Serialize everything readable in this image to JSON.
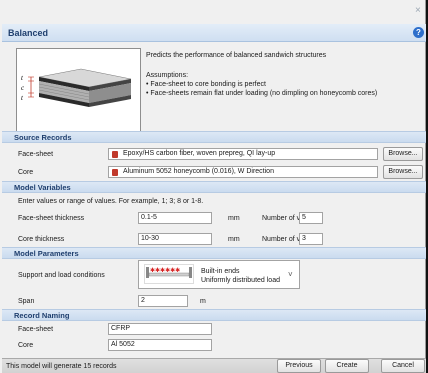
{
  "window": {
    "close_glyph": "×"
  },
  "header": {
    "title": "Balanced",
    "help_icon": "?"
  },
  "intro": {
    "description": "Predicts the performance of balanced sandwich structures",
    "assumptions_title": "Assumptions:",
    "assumptions": [
      "• Face-sheet to core bonding is perfect",
      "• Face-sheets remain flat under loading (no dimpling on honeycomb cores)"
    ],
    "diagram_labels": {
      "t1": "t",
      "c": "c",
      "t2": "t"
    }
  },
  "source_records": {
    "title": "Source Records",
    "rows": [
      {
        "label": "Face-sheet",
        "value": "Epoxy/HS carbon fiber, woven prepreg, QI lay-up",
        "button": "Browse..."
      },
      {
        "label": "Core",
        "value": "Aluminum 5052 honeycomb (0.016), W Direction",
        "button": "Browse..."
      }
    ]
  },
  "model_variables": {
    "title": "Model Variables",
    "hint": "Enter values or range of values. For example, 1; 3; 8 or 1-8.",
    "rows": [
      {
        "label": "Face-sheet thickness",
        "value": "0.1-5",
        "unit": "mm",
        "count_label": "Number of values:",
        "count": "5"
      },
      {
        "label": "Core thickness",
        "value": "10-30",
        "unit": "mm",
        "count_label": "Number of values:",
        "count": "3"
      }
    ]
  },
  "model_parameters": {
    "title": "Model Parameters",
    "support_label": "Support and load conditions",
    "support_line1": "Built-in ends",
    "support_line2": "Uniformly distributed load",
    "span_label": "Span",
    "span_value": "2",
    "span_unit": "m"
  },
  "record_naming": {
    "title": "Record Naming",
    "rows": [
      {
        "label": "Face-sheet",
        "value": "CFRP"
      },
      {
        "label": "Core",
        "value": "Al 5052"
      }
    ]
  },
  "footer": {
    "status": "This model will generate 15 records",
    "previous": "Previous",
    "create": "Create",
    "cancel": "Cancel"
  }
}
